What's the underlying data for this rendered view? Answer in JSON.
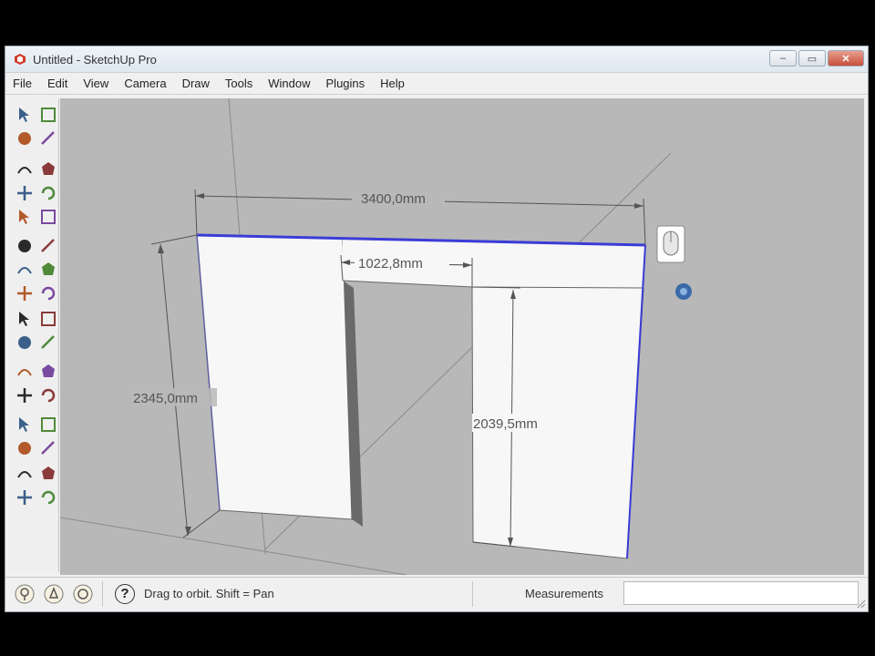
{
  "window": {
    "title": "Untitled - SketchUp Pro"
  },
  "menu": {
    "items": [
      "File",
      "Edit",
      "View",
      "Camera",
      "Draw",
      "Tools",
      "Window",
      "Plugins",
      "Help"
    ]
  },
  "window_buttons": {
    "minimize": "–",
    "maximize": "▭",
    "close": "✕"
  },
  "scene": {
    "dimensions": {
      "width": "3400,0mm",
      "opening_width": "1022,8mm",
      "height": "2345,0mm",
      "opening_height": "2039,5mm"
    }
  },
  "status": {
    "help_glyph": "?",
    "hint": "Drag to orbit.  Shift = Pan",
    "measurements_label": "Measurements",
    "measurements_value": ""
  },
  "colors": {
    "viewport": "#b8b8b8",
    "face": "#f7f7f7",
    "selected_edge": "#3b3bd8",
    "dimension": "#555555"
  },
  "icons": {
    "toolbar": [
      "select-icon",
      "component-icon",
      "paint-bucket-icon",
      "eraser-icon",
      "rectangle-icon",
      "line-icon",
      "circle-icon",
      "arc-icon",
      "polygon-icon",
      "freehand-icon",
      "move-icon",
      "push-pull-icon",
      "rotate-icon",
      "follow-me-icon",
      "scale-icon",
      "offset-icon",
      "tape-measure-icon",
      "dimension-icon",
      "protractor-icon",
      "text-icon",
      "axes-icon",
      "3d-text-icon",
      "orbit-icon",
      "pan-icon",
      "zoom-icon",
      "zoom-window-icon",
      "zoom-extents-icon",
      "previous-view-icon",
      "position-camera-icon",
      "look-around-icon",
      "walk-icon",
      "section-plane-icon"
    ],
    "status": [
      "geo-location-icon",
      "credits-icon",
      "user-icon",
      "help-icon"
    ]
  }
}
